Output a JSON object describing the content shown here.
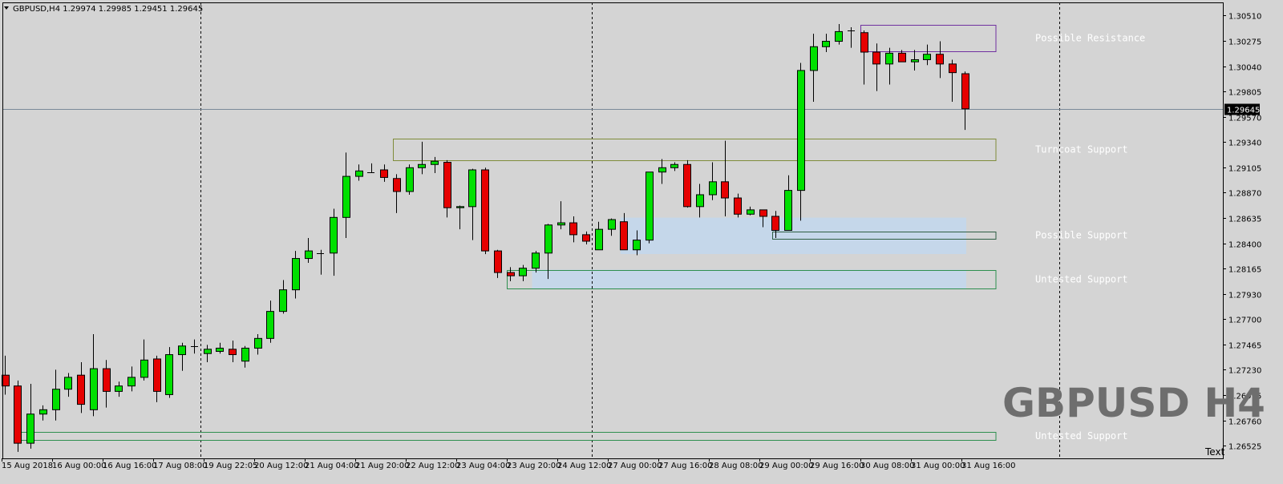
{
  "window": {
    "header": "GBPUSD,H4  1.29974 1.29985 1.29451 1.29645",
    "watermark": "GBPUSD H4",
    "corner_label": "Text",
    "current_price_label": "1.29645"
  },
  "chart_data": {
    "type": "candlestick",
    "symbol": "GBPUSD",
    "timeframe": "H4",
    "ylim": [
      1.2641,
      1.3063
    ],
    "y_ticks": [
      1.3051,
      1.30275,
      1.3004,
      1.29805,
      1.2957,
      1.2934,
      1.29105,
      1.2887,
      1.28635,
      1.284,
      1.28165,
      1.2793,
      1.277,
      1.27465,
      1.2723,
      1.26995,
      1.2676,
      1.26525
    ],
    "y_tick_labels": [
      "1.30510",
      "1.30275",
      "1.30040",
      "1.29805",
      "1.29570",
      "1.29340",
      "1.29105",
      "1.28870",
      "1.28635",
      "1.28400",
      "1.28165",
      "1.27930",
      "1.27700",
      "1.27465",
      "1.27230",
      "1.26995",
      "1.26760",
      "1.26525"
    ],
    "x_labels": [
      {
        "index": 0,
        "text": "15 Aug 2018"
      },
      {
        "index": 4,
        "text": "16 Aug 00:00"
      },
      {
        "index": 8,
        "text": "16 Aug 16:00"
      },
      {
        "index": 12,
        "text": "17 Aug 08:00"
      },
      {
        "index": 16,
        "text": "19 Aug 22:05"
      },
      {
        "index": 20,
        "text": "20 Aug 12:00"
      },
      {
        "index": 24,
        "text": "21 Aug 04:00"
      },
      {
        "index": 28,
        "text": "21 Aug 20:00"
      },
      {
        "index": 32,
        "text": "22 Aug 12:00"
      },
      {
        "index": 36,
        "text": "23 Aug 04:00"
      },
      {
        "index": 40,
        "text": "23 Aug 20:00"
      },
      {
        "index": 44,
        "text": "24 Aug 12:00"
      },
      {
        "index": 48,
        "text": "27 Aug 00:00"
      },
      {
        "index": 52,
        "text": "27 Aug 16:00"
      },
      {
        "index": 56,
        "text": "28 Aug 08:00"
      },
      {
        "index": 60,
        "text": "29 Aug 00:00"
      },
      {
        "index": 64,
        "text": "29 Aug 16:00"
      },
      {
        "index": 68,
        "text": "30 Aug 08:00"
      },
      {
        "index": 72,
        "text": "31 Aug 00:00"
      },
      {
        "index": 76,
        "text": "31 Aug 16:00"
      }
    ],
    "day_separators": [
      16,
      47,
      84
    ],
    "current_price": 1.29645,
    "candles": [
      [
        1.2718,
        1.2736,
        1.27,
        1.2708
      ],
      [
        1.2708,
        1.2713,
        1.2647,
        1.2655
      ],
      [
        1.2655,
        1.271,
        1.265,
        1.2682
      ],
      [
        1.2682,
        1.269,
        1.2676,
        1.2686
      ],
      [
        1.2686,
        1.2723,
        1.2676,
        1.2705
      ],
      [
        1.2705,
        1.272,
        1.2698,
        1.2716
      ],
      [
        1.2718,
        1.273,
        1.2683,
        1.2691
      ],
      [
        1.2686,
        1.2756,
        1.268,
        1.2724
      ],
      [
        1.2724,
        1.2732,
        1.2688,
        1.2703
      ],
      [
        1.2703,
        1.2712,
        1.2698,
        1.2708
      ],
      [
        1.2708,
        1.2726,
        1.2703,
        1.2716
      ],
      [
        1.2716,
        1.2751,
        1.2713,
        1.2732
      ],
      [
        1.2733,
        1.2736,
        1.2693,
        1.2703
      ],
      [
        1.27,
        1.2744,
        1.2697,
        1.2737
      ],
      [
        1.2737,
        1.2748,
        1.2722,
        1.2745
      ],
      [
        1.2745,
        1.2751,
        1.2738,
        1.2745
      ],
      [
        1.2738,
        1.2746,
        1.273,
        1.2742
      ],
      [
        1.274,
        1.2748,
        1.2738,
        1.2743
      ],
      [
        1.2742,
        1.275,
        1.273,
        1.2737
      ],
      [
        1.2731,
        1.2745,
        1.2725,
        1.2743
      ],
      [
        1.2743,
        1.2756,
        1.2737,
        1.2752
      ],
      [
        1.2752,
        1.2787,
        1.2748,
        1.2777
      ],
      [
        1.2777,
        1.2806,
        1.2775,
        1.2797
      ],
      [
        1.2797,
        1.2833,
        1.2789,
        1.2826
      ],
      [
        1.2826,
        1.2845,
        1.2822,
        1.2833
      ],
      [
        1.2831,
        1.2834,
        1.2811,
        1.2831
      ],
      [
        1.2831,
        1.2872,
        1.281,
        1.2864
      ],
      [
        1.2864,
        1.2924,
        1.2845,
        1.2902
      ],
      [
        1.2902,
        1.2913,
        1.2898,
        1.2907
      ],
      [
        1.2906,
        1.2914,
        1.2905,
        1.2906
      ],
      [
        1.2908,
        1.2913,
        1.2897,
        1.2901
      ],
      [
        1.29,
        1.2904,
        1.2868,
        1.2888
      ],
      [
        1.2888,
        1.2913,
        1.2885,
        1.291
      ],
      [
        1.291,
        1.2934,
        1.2904,
        1.2913
      ],
      [
        1.2913,
        1.292,
        1.2905,
        1.2916
      ],
      [
        1.2915,
        1.2917,
        1.2864,
        1.2873
      ],
      [
        1.2873,
        1.2875,
        1.2853,
        1.2874
      ],
      [
        1.2874,
        1.2909,
        1.2843,
        1.2908
      ],
      [
        1.2908,
        1.291,
        1.283,
        1.2833
      ],
      [
        1.2833,
        1.2834,
        1.2808,
        1.2813
      ],
      [
        1.2813,
        1.2818,
        1.2805,
        1.281
      ],
      [
        1.281,
        1.282,
        1.2805,
        1.2817
      ],
      [
        1.2817,
        1.2833,
        1.2813,
        1.2831
      ],
      [
        1.2831,
        1.2858,
        1.2807,
        1.2857
      ],
      [
        1.2857,
        1.2879,
        1.2853,
        1.2859
      ],
      [
        1.2859,
        1.2865,
        1.2841,
        1.2848
      ],
      [
        1.2848,
        1.2851,
        1.2839,
        1.2842
      ],
      [
        1.2834,
        1.286,
        1.2834,
        1.2853
      ],
      [
        1.2853,
        1.2863,
        1.2847,
        1.2862
      ],
      [
        1.286,
        1.2868,
        1.2834,
        1.2834
      ],
      [
        1.2834,
        1.2852,
        1.2829,
        1.2843
      ],
      [
        1.2843,
        1.2906,
        1.284,
        1.2906
      ],
      [
        1.2906,
        1.2918,
        1.2895,
        1.291
      ],
      [
        1.291,
        1.2915,
        1.2907,
        1.2913
      ],
      [
        1.2913,
        1.2917,
        1.2873,
        1.2874
      ],
      [
        1.2874,
        1.2895,
        1.2864,
        1.2885
      ],
      [
        1.2885,
        1.2915,
        1.288,
        1.2897
      ],
      [
        1.2897,
        1.2935,
        1.2865,
        1.2882
      ],
      [
        1.2882,
        1.2886,
        1.2864,
        1.2867
      ],
      [
        1.2867,
        1.2874,
        1.2866,
        1.2871
      ],
      [
        1.2871,
        1.2871,
        1.2855,
        1.2865
      ],
      [
        1.2865,
        1.287,
        1.2845,
        1.2852
      ],
      [
        1.2852,
        1.2903,
        1.2852,
        1.2889
      ],
      [
        1.2889,
        1.3007,
        1.2861,
        1.3
      ],
      [
        1.3,
        1.3034,
        1.2971,
        1.3022
      ],
      [
        1.3022,
        1.3034,
        1.3017,
        1.3027
      ],
      [
        1.3027,
        1.3043,
        1.3024,
        1.3036
      ],
      [
        1.3037,
        1.304,
        1.3021,
        1.3037
      ],
      [
        1.3035,
        1.3037,
        1.2987,
        1.3017
      ],
      [
        1.3017,
        1.3025,
        1.2981,
        1.3006
      ],
      [
        1.3006,
        1.3021,
        1.2987,
        1.3016
      ],
      [
        1.3016,
        1.3019,
        1.3009,
        1.3008
      ],
      [
        1.3008,
        1.3019,
        1.3,
        1.301
      ],
      [
        1.301,
        1.3024,
        1.3005,
        1.3015
      ],
      [
        1.3015,
        1.3027,
        1.2993,
        1.3006
      ],
      [
        1.3006,
        1.301,
        1.2971,
        1.2998
      ],
      [
        1.2997,
        1.2999,
        1.2945,
        1.29645
      ]
    ],
    "zones": [
      {
        "label": "Possible Resistance",
        "y_top": 1.30426,
        "y_bottom": 1.30175,
        "x_start": 68,
        "border": "#7030a0",
        "fill": "none"
      },
      {
        "label": "Turncoat Support",
        "y_top": 1.29371,
        "y_bottom": 1.29166,
        "x_start": 31,
        "border": "#7f8c3a",
        "fill": "none"
      },
      {
        "label": "Possible Support",
        "y_top": 1.28511,
        "y_bottom": 1.28441,
        "x_start": 61,
        "border": "#2e5e43",
        "fill": "none"
      },
      {
        "label": "Untested Support",
        "y_top": 1.28156,
        "y_bottom": 1.2798,
        "x_start": 40,
        "border": "#2e8f4f",
        "fill": "none"
      },
      {
        "label": "Untested Support",
        "y_top": 1.26658,
        "y_bottom": 1.26577,
        "x_start": 1,
        "border": "#2e8f4f",
        "fill": "none"
      }
    ],
    "light_zones": [
      {
        "y_top": 1.28638,
        "y_bottom": 1.28301,
        "x_start": 49
      },
      {
        "y_top": 1.28156,
        "y_bottom": 1.2798,
        "x_start": 42
      }
    ],
    "colors": {
      "bull": "#00e000",
      "bear": "#e60000",
      "background": "#d4d4d4",
      "grid_separator": "#000000",
      "price_line": "#7a8a99",
      "light_zone": "#c5d7ea"
    }
  }
}
